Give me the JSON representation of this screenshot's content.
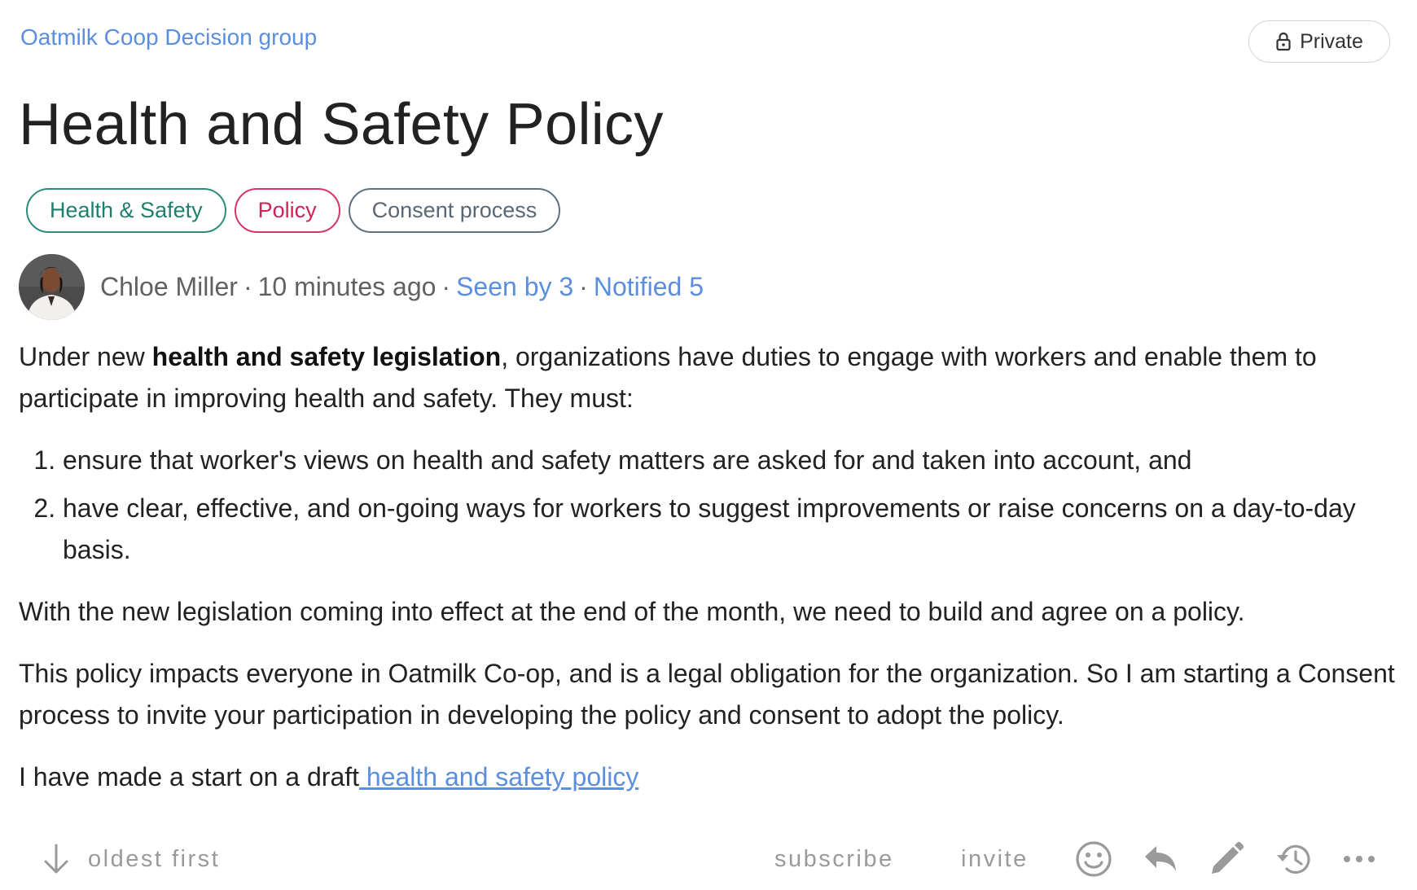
{
  "header": {
    "group_name": "Oatmilk Coop Decision group",
    "privacy_label": "Private",
    "privacy_icon": "lock-icon"
  },
  "thread": {
    "title": "Health and Safety Policy",
    "tags": [
      {
        "label": "Health & Safety",
        "color": "#2c8c7a"
      },
      {
        "label": "Policy",
        "color": "#d63565"
      },
      {
        "label": "Consent process",
        "color": "#5f7180"
      }
    ],
    "author": "Chloe Miller",
    "time_ago": "10 minutes ago",
    "seen_by": "Seen by 3",
    "notified": "Notified 5",
    "separator": "·"
  },
  "body": {
    "p1_before": "Under new ",
    "p1_bold": "health and safety legislation",
    "p1_after": ", organizations have duties to engage with workers and enable them to participate in improving health and safety. They must:",
    "list": [
      "ensure that worker's views on health and safety matters are asked for and taken into account, and",
      "have clear, effective, and on-going ways for workers to suggest improvements or raise concerns on a day-to-day basis."
    ],
    "p2": "With the new legislation coming into effect at the end of the month, we need to build and agree on a policy.",
    "p3": "This policy impacts everyone in Oatmilk Co-op, and is a legal obligation for the organization. So I am starting a Consent process to invite your participation in developing the policy and consent to adopt the policy.",
    "p4_before": "I have made a start on a draft",
    "p4_link": " health and safety policy"
  },
  "actions": {
    "sort_label": "oldest first",
    "subscribe_label": "subscribe",
    "invite_label": "invite",
    "icons": [
      "arrow-down-icon",
      "emoji-icon",
      "reply-icon",
      "edit-icon",
      "history-icon",
      "more-icon"
    ]
  },
  "colors": {
    "link": "#5c8ee0",
    "muted": "#9a9a9a"
  }
}
